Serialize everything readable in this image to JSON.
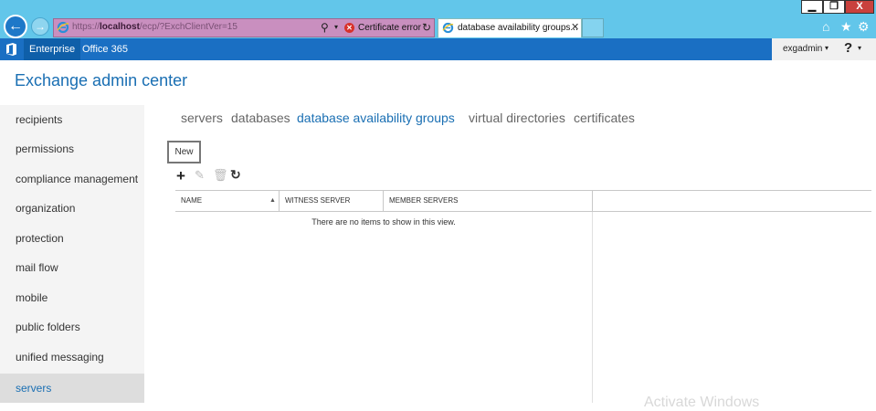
{
  "browser": {
    "url_prefix": "https://",
    "url_host": "localhost",
    "url_path": "/ecp/?ExchClientVer=15",
    "certificate_error": "Certificate error",
    "tab_title": "database availability groups...",
    "icons": {
      "back": "back-arrow-icon",
      "forward": "forward-arrow-icon",
      "search": "search-icon",
      "refresh": "refresh-icon",
      "home": "home-icon",
      "favorites": "star-icon",
      "tools": "gear-icon"
    },
    "window_buttons": {
      "minimize": "▁",
      "maximize": "❐",
      "close": "X"
    },
    "glyphs": {
      "back": "←",
      "forward": "→",
      "search": "⚲",
      "dropdown": "▾",
      "cert": "✕",
      "refresh": "↻",
      "tab_close": "✕",
      "home": "⌂",
      "favorites": "★",
      "tools": "⚙"
    }
  },
  "suite_bar": {
    "nav": [
      "Enterprise",
      "Office 365"
    ],
    "user_name": "exgadmin",
    "user_caret": "▾",
    "help_label": "?",
    "help_caret": "▾",
    "color": "#1a6fc3"
  },
  "header": {
    "title": "Exchange admin center"
  },
  "sidebar": {
    "items": [
      {
        "label": "recipients"
      },
      {
        "label": "permissions"
      },
      {
        "label": "compliance management"
      },
      {
        "label": "organization"
      },
      {
        "label": "protection"
      },
      {
        "label": "mail flow"
      },
      {
        "label": "mobile"
      },
      {
        "label": "public folders"
      },
      {
        "label": "unified messaging"
      },
      {
        "label": "servers",
        "selected": true
      }
    ]
  },
  "main": {
    "tabs": [
      {
        "label": "servers"
      },
      {
        "label": "databases"
      },
      {
        "label": "database availability groups",
        "active": true
      },
      {
        "label": "virtual directories"
      },
      {
        "label": "certificates"
      }
    ],
    "tooltip": "New",
    "toolbar": {
      "add": "+",
      "edit": "✎",
      "delete": "🗑",
      "refresh": "↻",
      "icons": [
        "plus-icon",
        "pencil-icon",
        "trash-icon",
        "refresh-icon"
      ]
    },
    "table": {
      "columns": [
        "NAME",
        "WITNESS SERVER",
        "MEMBER SERVERS"
      ],
      "sort_indicator": "▲",
      "empty_message": "There are no items to show in this view."
    },
    "watermark": "Activate Windows"
  },
  "colors": {
    "accent": "#1a6fb3",
    "chrome": "#62c6ea",
    "address_bar": "#c98fbf",
    "close_button": "#c9413d"
  }
}
